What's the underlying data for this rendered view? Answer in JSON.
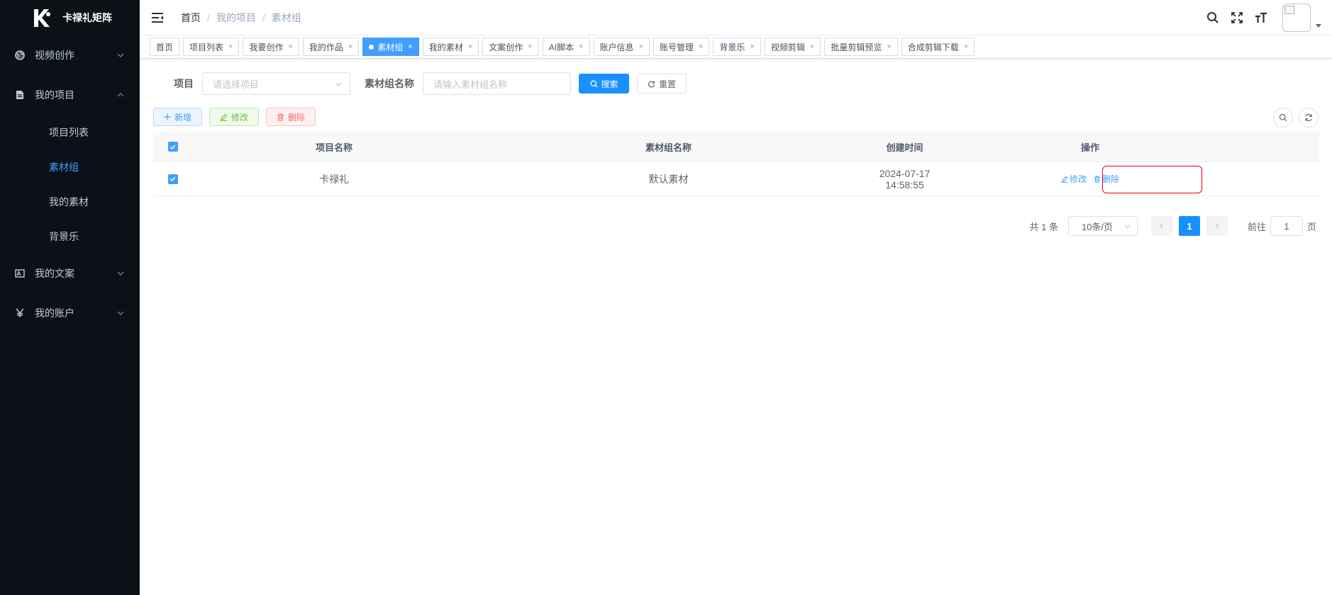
{
  "app": {
    "logo_icon": "k-logo-icon",
    "name": "卡禄礼矩阵"
  },
  "sidebar": {
    "active_color": "#409eff",
    "background": "#0b1116",
    "menu": [
      {
        "label": "视频创作",
        "icon": "globe-icon",
        "expanded": false
      },
      {
        "label": "我的项目",
        "icon": "document-icon",
        "expanded": true,
        "children": [
          {
            "label": "项目列表",
            "active": false
          },
          {
            "label": "素材组",
            "active": true
          },
          {
            "label": "我的素材",
            "active": false
          },
          {
            "label": "背景乐",
            "active": false
          }
        ]
      },
      {
        "label": "我的文案",
        "icon": "text-image-icon",
        "expanded": false
      },
      {
        "label": "我的账户",
        "icon": "yen-icon",
        "expanded": false
      }
    ]
  },
  "header": {
    "breadcrumb": [
      "首页",
      "我的项目",
      "素材组"
    ],
    "icons": [
      "search-icon",
      "fullscreen-icon",
      "font-size-icon"
    ]
  },
  "tags": [
    {
      "label": "首页",
      "closable": false,
      "active": false
    },
    {
      "label": "项目列表",
      "closable": true,
      "active": false
    },
    {
      "label": "我要创作",
      "closable": true,
      "active": false
    },
    {
      "label": "我的作品",
      "closable": true,
      "active": false
    },
    {
      "label": "素材组",
      "closable": true,
      "active": true
    },
    {
      "label": "我的素材",
      "closable": true,
      "active": false
    },
    {
      "label": "文案创作",
      "closable": true,
      "active": false
    },
    {
      "label": "AI脚本",
      "closable": true,
      "active": false
    },
    {
      "label": "账户信息",
      "closable": true,
      "active": false
    },
    {
      "label": "账号管理",
      "closable": true,
      "active": false
    },
    {
      "label": "背景乐",
      "closable": true,
      "active": false
    },
    {
      "label": "视频剪辑",
      "closable": true,
      "active": false
    },
    {
      "label": "批量剪辑预览",
      "closable": true,
      "active": false
    },
    {
      "label": "合成剪辑下载",
      "closable": true,
      "active": false
    }
  ],
  "search_form": {
    "project_label": "项目",
    "project_placeholder": "请选择项目",
    "group_name_label": "素材组名称",
    "group_name_placeholder": "请输入素材组名称",
    "search_button": "搜索",
    "reset_button": "重置"
  },
  "toolbar": {
    "add": "新增",
    "edit": "修改",
    "delete": "删除"
  },
  "table": {
    "columns": [
      "项目名称",
      "素材组名称",
      "创建时间",
      "操作"
    ],
    "rows": [
      {
        "project": "卡禄礼",
        "group": "默认素材",
        "created": "2024-07-17 14:58:55",
        "checked": true
      }
    ],
    "row_actions": {
      "edit": "修改",
      "delete": "删除"
    }
  },
  "pagination": {
    "total_text": "共 1 条",
    "page_size": "10条/页",
    "current_page": "1",
    "goto_label": "前往",
    "goto_value": "1",
    "page_suffix": "页"
  }
}
